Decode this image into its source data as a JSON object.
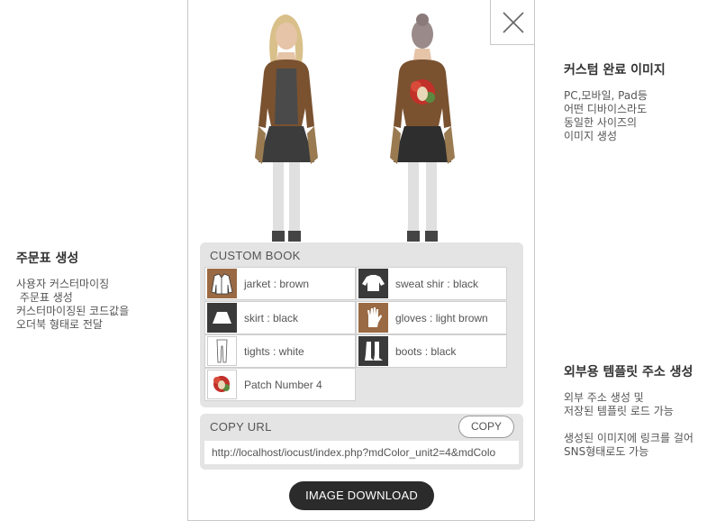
{
  "left_note": {
    "title": "주문표 생성",
    "lines": [
      "사용자 커스터마이징",
      " 주문표 생성",
      "커스터마이징된 코드값을",
      "오더북 형태로 전달"
    ]
  },
  "right_top_note": {
    "title": "커스텀 완료 이미지",
    "lines": [
      "PC,모바일, Pad등",
      "어떤 디바이스라도",
      "동일한 사이즈의",
      "이미지 생성"
    ]
  },
  "right_bottom_note": {
    "title": "외부용 템플릿 주소 생성",
    "lines": [
      "외부 주소 생성 및",
      "저장된 템플릿 로드 가능"
    ],
    "lines2": [
      "생성된 이미지에 링크를 걸어",
      "SNS형태로도 가능"
    ]
  },
  "popup": {
    "custom_book_title": "CUSTOM BOOK",
    "items": [
      {
        "label": "jarket : brown",
        "icon": "jacket-icon"
      },
      {
        "label": "sweat shir : black",
        "icon": "sweatshirt-icon"
      },
      {
        "label": "skirt : black",
        "icon": "skirt-icon"
      },
      {
        "label": "gloves : light brown",
        "icon": "glove-icon"
      },
      {
        "label": "tights : white",
        "icon": "tights-icon"
      },
      {
        "label": "boots : black",
        "icon": "boots-icon"
      },
      {
        "label": "Patch Number 4",
        "icon": "patch-icon"
      }
    ],
    "copy_url_title": "COPY URL",
    "copy_button": "COPY",
    "url_value": "http://localhost/iocust/index.php?mdColor_unit2=4&mdColo",
    "download_button": "IMAGE DOWNLOAD"
  },
  "colors": {
    "jacket": "#7a5230",
    "skirt": "#3c3c3c",
    "tights": "#e4e4e4",
    "panel_bg": "#e4e4e4",
    "button_dark": "#2b2b2b"
  }
}
